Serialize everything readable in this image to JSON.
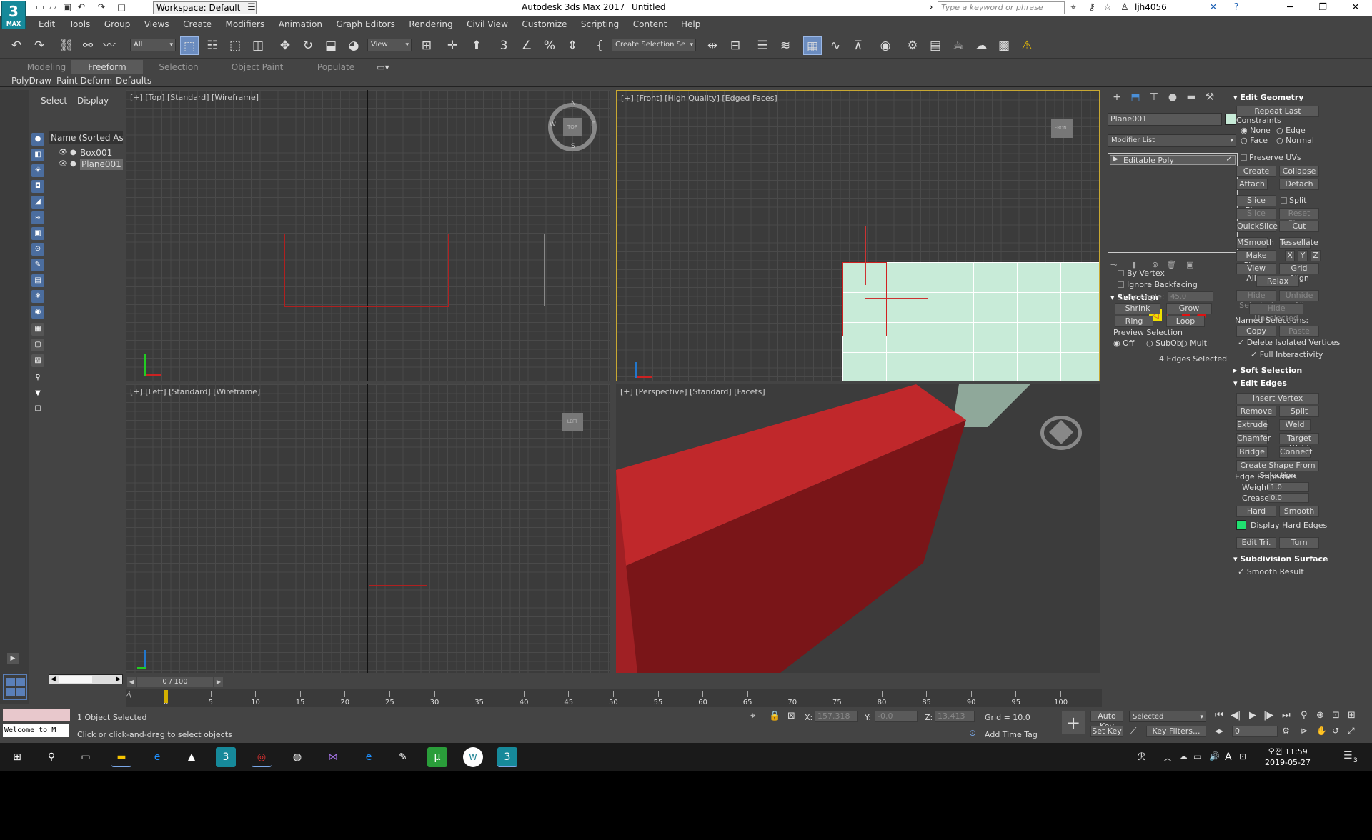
{
  "window": {
    "app_title": "Autodesk 3ds Max 2017",
    "doc_title": "Untitled",
    "workspace": "Workspace: Default",
    "search_placeholder": "Type a keyword or phrase",
    "user": "ljh4056",
    "logo_text": "3",
    "logo_sub": "MAX"
  },
  "menu": [
    "Edit",
    "Tools",
    "Group",
    "Views",
    "Create",
    "Modifiers",
    "Animation",
    "Graph Editors",
    "Rendering",
    "Civil View",
    "Customize",
    "Scripting",
    "Content",
    "Help"
  ],
  "toolbar": {
    "filter": "All",
    "view_dropdown": "View",
    "selection_set": "Create Selection Se"
  },
  "ribbon": {
    "tabs": [
      "Modeling",
      "Freeform",
      "Selection",
      "Object Paint",
      "Populate"
    ],
    "subtabs": [
      "PolyDraw",
      "Paint Deform",
      "Defaults"
    ]
  },
  "scene_explorer": {
    "tabs": [
      "Select",
      "Display"
    ],
    "column_header": "Name (Sorted Asc",
    "objects": [
      "Box001",
      "Plane001"
    ],
    "scroll_value": ""
  },
  "viewports": {
    "top": "[+] [Top] [Standard] [Wireframe]",
    "front": "[+] [Front] [High Quality] [Edged Faces]",
    "left": "[+] [Left] [Standard] [Wireframe]",
    "perspective": "[+] [Perspective] [Standard] [Facets]",
    "cube_top": "TOP",
    "cube_front": "FRONT",
    "cube_left": "LEFT",
    "compass": [
      "N",
      "E",
      "S",
      "W"
    ]
  },
  "command_panel": {
    "object_name": "Plane001",
    "modifier_list": "Modifier List",
    "stack_item": "Editable Poly",
    "selection": {
      "title": "Selection",
      "by_vertex": "By Vertex",
      "ignore_backfacing": "Ignore Backfacing",
      "by_angle": "By Angle:",
      "angle_value": "45.0",
      "shrink": "Shrink",
      "grow": "Grow",
      "ring": "Ring",
      "loop": "Loop",
      "preview_title": "Preview Selection",
      "preview_options": [
        "Off",
        "SubObj",
        "Multi"
      ],
      "status": "4 Edges Selected"
    },
    "edit_geometry": {
      "title": "Edit Geometry",
      "repeat_last": "Repeat Last",
      "constraints": "Constraints",
      "constraint_options": [
        "None",
        "Edge",
        "Face",
        "Normal"
      ],
      "preserve_uvs": "Preserve UVs",
      "create": "Create",
      "collapse": "Collapse",
      "attach": "Attach",
      "detach": "Detach",
      "slice_plane": "Slice Plane",
      "split": "Split",
      "slice": "Slice",
      "reset_plane": "Reset Plane",
      "quickslice": "QuickSlice",
      "cut": "Cut",
      "msmooth": "MSmooth",
      "tessellate": "Tessellate",
      "make_planar": "Make Planar",
      "x": "X",
      "y": "Y",
      "z": "Z",
      "view_align": "View Align",
      "grid_align": "Grid Align",
      "relax": "Relax",
      "hide_selected": "Hide Selected",
      "unhide_all": "Unhide All",
      "hide_unselected": "Hide Unselected",
      "named_selections": "Named Selections:",
      "copy": "Copy",
      "paste": "Paste",
      "delete_isolated": "Delete Isolated Vertices",
      "full_interactivity": "Full Interactivity"
    },
    "soft_selection": "Soft Selection",
    "edit_edges": {
      "title": "Edit Edges",
      "insert_vertex": "Insert Vertex",
      "remove": "Remove",
      "split": "Split",
      "extrude": "Extrude",
      "weld": "Weld",
      "chamfer": "Chamfer",
      "target_weld": "Target Weld",
      "bridge": "Bridge",
      "connect": "Connect",
      "create_shape": "Create Shape From Selection",
      "edge_properties": "Edge Properties",
      "weight_label": "Weight:",
      "weight": "1.0",
      "crease_label": "Crease:",
      "crease": "0.0",
      "hard": "Hard",
      "smooth": "Smooth",
      "display_hard_edges": "Display Hard Edges",
      "edit_tri": "Edit Tri.",
      "turn": "Turn"
    },
    "subdivision_surface": "Subdivision Surface",
    "smooth_result": "Smooth Result"
  },
  "timeline": {
    "position": "0 / 100",
    "current_frame": 0,
    "ticks": [
      "0",
      "5",
      "10",
      "15",
      "20",
      "25",
      "30",
      "35",
      "40",
      "45",
      "50",
      "55",
      "60",
      "65",
      "70",
      "75",
      "80",
      "85",
      "90",
      "95",
      "100"
    ]
  },
  "status": {
    "selected": "1 Object Selected",
    "prompt": "Click or click-and-drag to select objects",
    "maxscript": "Welcome to M",
    "x_label": "X:",
    "x": "157.318",
    "y_label": "Y:",
    "y": "-0.0",
    "z_label": "Z:",
    "z": "13.413",
    "grid": "Grid = 10.0",
    "add_time_tag": "Add Time Tag",
    "auto_key": "Auto Key",
    "set_key": "Set Key",
    "key_mode": "Selected",
    "key_filters": "Key Filters...",
    "frame": "0"
  },
  "taskbar": {
    "time": "오전 11:59",
    "date": "2019-05-27",
    "notif": "3",
    "ime": "A"
  }
}
